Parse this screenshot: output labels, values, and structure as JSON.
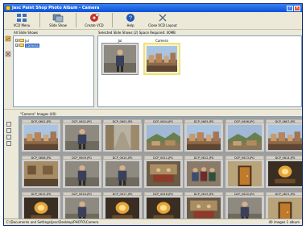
{
  "window": {
    "title": "Jasc Paint Shop Photo Album - Camera"
  },
  "toolbar": {
    "items": [
      {
        "label": "VCD Menu",
        "icon": "vcd-menu-icon"
      },
      {
        "label": "Slide Show",
        "icon": "slide-show-icon"
      },
      {
        "label": "Create VCD",
        "icon": "create-vcd-icon"
      },
      {
        "label": "Help",
        "icon": "help-icon"
      },
      {
        "label": "Close VCD Layout",
        "icon": "close-layout-icon"
      }
    ]
  },
  "tree": {
    "label": "All Slide Shows",
    "items": [
      {
        "label": "Jul",
        "selected": false
      },
      {
        "label": "Camera",
        "selected": true
      }
    ]
  },
  "selected_panel": {
    "label": "Selected Slide Shows (2)  Space Required: 40MB",
    "items": [
      {
        "caption": "Jul",
        "active": false,
        "scene": "person"
      },
      {
        "caption": "Camera",
        "active": true,
        "scene": "town"
      }
    ]
  },
  "images_panel": {
    "label": "\"Camera\" Images (40)",
    "rows": [
      [
        {
          "caption": "DCP_0601.JPG",
          "scene": "town"
        },
        {
          "caption": "DCP_0602.JPG",
          "scene": "person"
        },
        {
          "caption": "DCP_0603.JPG",
          "scene": "street"
        },
        {
          "caption": "DCP_0604.JPG",
          "scene": "hills"
        },
        {
          "caption": "DCP_0605.JPG",
          "scene": "town"
        },
        {
          "caption": "DCP_0606.JPG",
          "scene": "hills"
        },
        {
          "caption": "DCP_0607.JPG",
          "scene": "town"
        }
      ],
      [
        {
          "caption": "DCP_0608.JPG",
          "scene": "wall"
        },
        {
          "caption": "DCP_0609.JPG",
          "scene": "person"
        },
        {
          "caption": "DCP_0610.JPG",
          "scene": "person"
        },
        {
          "caption": "DCP_0611.JPG",
          "scene": "indoor"
        },
        {
          "caption": "DCP_0612.JPG",
          "scene": "group"
        },
        {
          "caption": "DCP_0613.JPG",
          "scene": "door"
        },
        {
          "caption": "DCP_0614.JPG",
          "scene": "lamp"
        }
      ],
      [
        {
          "caption": "DCP_0615.JPG",
          "scene": "lamp"
        },
        {
          "caption": "DCP_0616.JPG",
          "scene": "person"
        },
        {
          "caption": "DCP_0617.JPG",
          "scene": "lamp"
        },
        {
          "caption": "DCP_0618.JPG",
          "scene": "lamp"
        },
        {
          "caption": "DCP_0619.JPG",
          "scene": "indoor"
        },
        {
          "caption": "DCP_0620.JPG",
          "scene": "person"
        },
        {
          "caption": "DCP_0621.JPG",
          "scene": "door"
        }
      ]
    ]
  },
  "status": {
    "path": "C:\\Documents and Settings\\Jasc\\Desktop\\PHOTO\\Camera",
    "count": "40 images 1 album"
  },
  "colors": {
    "title_bar": "#0a52d6",
    "selection": "#316ac5",
    "active_frame": "#ede27a",
    "grid_background": "#9e9e9e"
  }
}
